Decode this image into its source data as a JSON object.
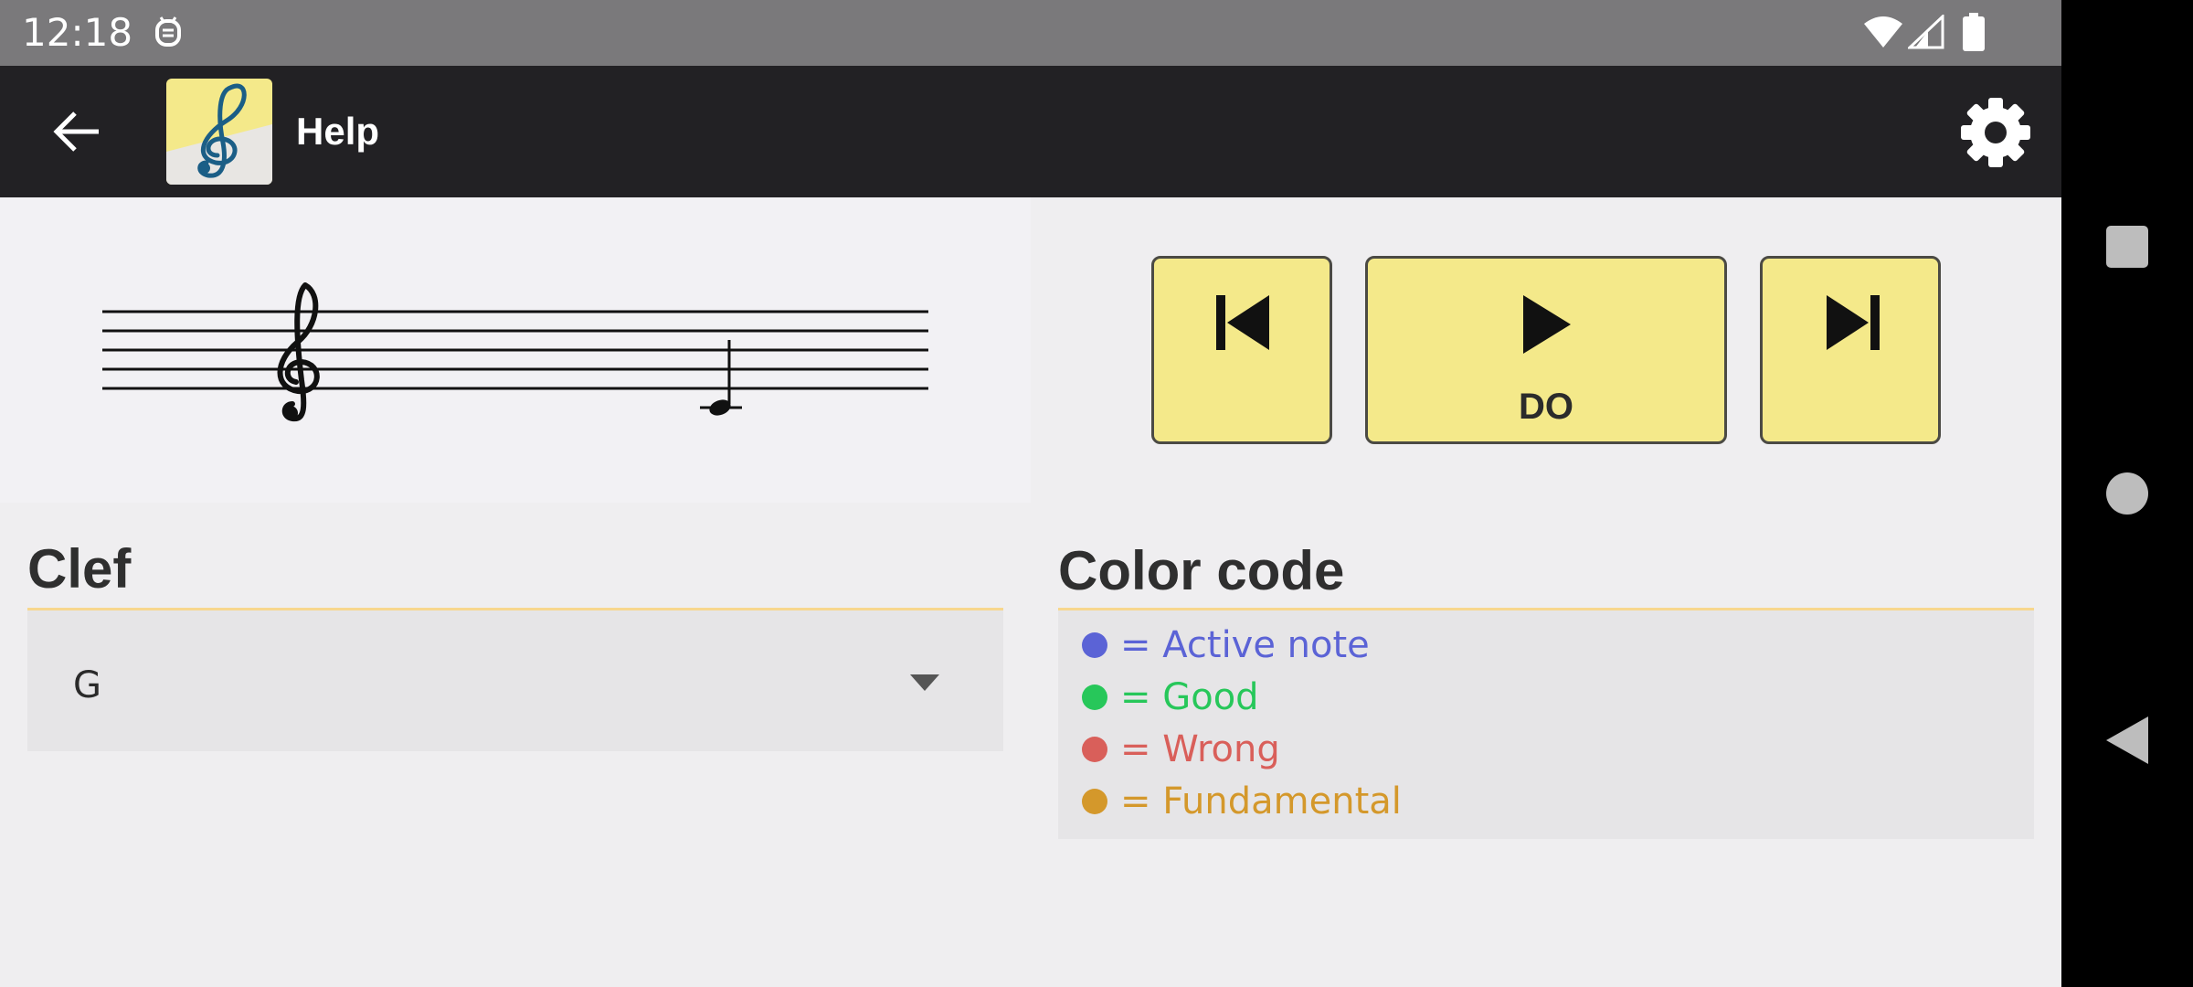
{
  "status_bar": {
    "time": "12:18",
    "icons": [
      "notification-icon",
      "wifi-icon",
      "signal-icon",
      "battery-icon"
    ]
  },
  "app_bar": {
    "title": "Help",
    "back_icon": "arrow-left-icon",
    "logo_icon": "treble-clef-logo-icon",
    "settings_icon": "gear-icon"
  },
  "player": {
    "prev_icon": "skip-previous-icon",
    "play_icon": "play-icon",
    "play_label": "DO",
    "next_icon": "skip-next-icon",
    "button_color": "#f4e98a"
  },
  "staff": {
    "clef_symbol": "treble-clef-icon",
    "note": "quarter-note-icon"
  },
  "clef_section": {
    "heading": "Clef",
    "selected_value": "G",
    "dropdown_icon": "caret-down-icon"
  },
  "color_code_section": {
    "heading": "Color code",
    "items": [
      {
        "label": "= Active note",
        "color": "#5b63d6"
      },
      {
        "label": "= Good",
        "color": "#27c75a"
      },
      {
        "label": "= Wrong",
        "color": "#d95f5a"
      },
      {
        "label": "= Fundamental",
        "color": "#d4982b"
      }
    ]
  },
  "colors": {
    "accent": "#f7d78e",
    "app_bar": "#222124",
    "status_bar": "#7a797b"
  },
  "nav_bar": {
    "items": [
      "recents-square-icon",
      "home-circle-icon",
      "back-triangle-icon"
    ]
  }
}
